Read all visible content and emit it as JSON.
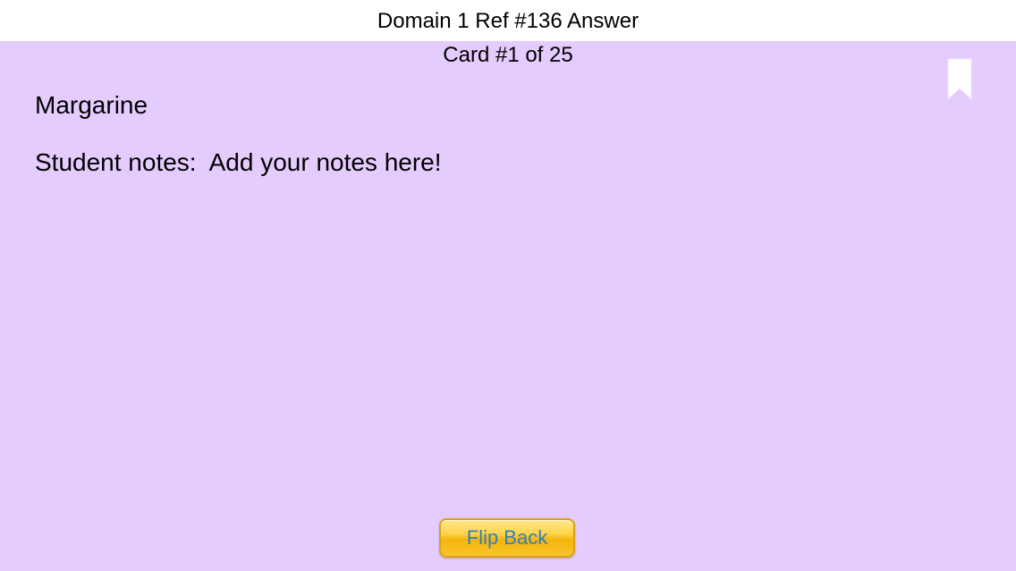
{
  "header": {
    "title": "Domain 1 Ref #136 Answer"
  },
  "card": {
    "counter": "Card #1 of 25",
    "answer": "Margarine",
    "notes": "Student notes:  Add your notes here!",
    "background_color": "#e5ccfe"
  },
  "bookmark": {
    "icon": "bookmark-icon",
    "color": "#ffffff"
  },
  "footer": {
    "flip_back_label": "Flip Back",
    "button_color": "#fdd44b",
    "button_text_color": "#2f7fc0"
  }
}
